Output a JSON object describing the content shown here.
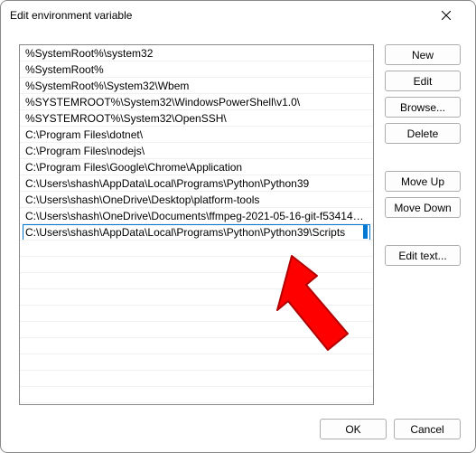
{
  "window": {
    "title": "Edit environment variable"
  },
  "list": {
    "items": [
      "%SystemRoot%\\system32",
      "%SystemRoot%",
      "%SystemRoot%\\System32\\Wbem",
      "%SYSTEMROOT%\\System32\\WindowsPowerShell\\v1.0\\",
      "%SYSTEMROOT%\\System32\\OpenSSH\\",
      "C:\\Program Files\\dotnet\\",
      "C:\\Program Files\\nodejs\\",
      "C:\\Program Files\\Google\\Chrome\\Application",
      "C:\\Users\\shash\\AppData\\Local\\Programs\\Python\\Python39",
      "C:\\Users\\shash\\OneDrive\\Desktop\\platform-tools",
      "C:\\Users\\shash\\OneDrive\\Documents\\ffmpeg-2021-05-16-git-f53414a..."
    ],
    "editing_value": "C:\\Users\\shash\\AppData\\Local\\Programs\\Python\\Python39\\Scripts"
  },
  "side": {
    "new": "New",
    "edit": "Edit",
    "browse": "Browse...",
    "delete": "Delete",
    "moveup": "Move Up",
    "movedown": "Move Down",
    "edittext": "Edit text..."
  },
  "footer": {
    "ok": "OK",
    "cancel": "Cancel"
  }
}
